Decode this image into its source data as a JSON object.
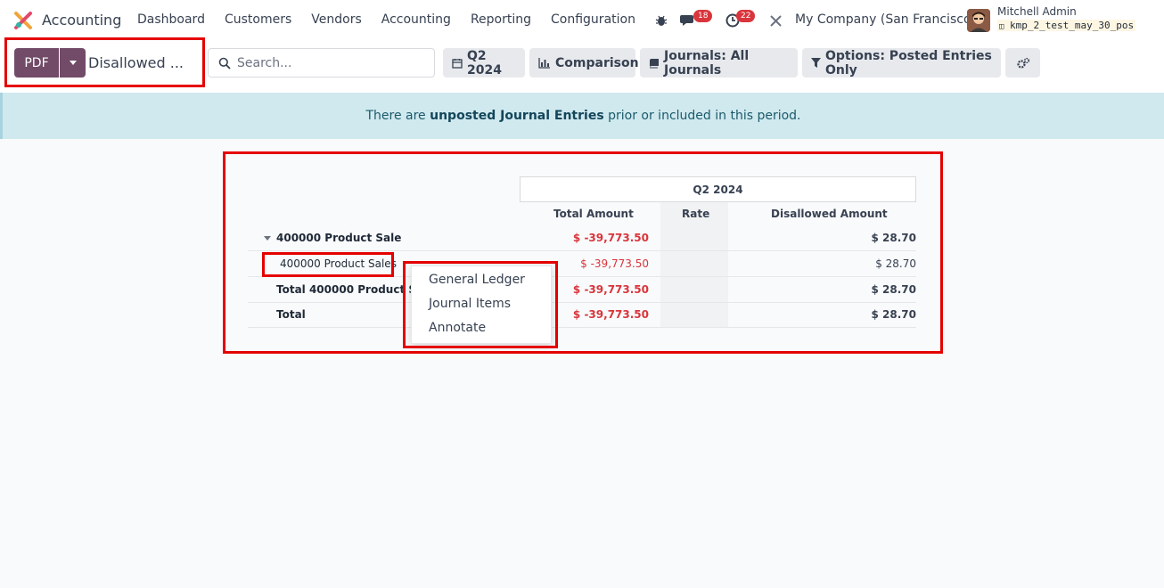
{
  "app": {
    "name": "Accounting",
    "menu": [
      "Dashboard",
      "Customers",
      "Vendors",
      "Accounting",
      "Reporting",
      "Configuration"
    ]
  },
  "systray": {
    "messages_count": "18",
    "activities_count": "22",
    "company": "My Company (San Francisco)",
    "user_name": "Mitchell Admin",
    "database": "kmp_2_test_may_30_pos"
  },
  "control": {
    "pdf_label": "PDF",
    "report_title": "Disallowed ...",
    "search_placeholder": "Search...",
    "filters": {
      "period": "Q2 2024",
      "comparison": "Comparison",
      "journals": "Journals: All Journals",
      "options": "Options: Posted Entries Only"
    }
  },
  "alert": {
    "prefix": "There are ",
    "emphasis": "unposted Journal Entries",
    "suffix": " prior or included in this period."
  },
  "report": {
    "period_header": "Q2 2024",
    "columns": [
      "Total Amount",
      "Rate",
      "Disallowed Amount"
    ],
    "rows": [
      {
        "label": "400000 Product Sale",
        "total_amount": "$ -39,773.50",
        "rate": "",
        "disallowed_amount": "$ 28.70"
      },
      {
        "label": "400000 Product Sales",
        "total_amount": "$ -39,773.50",
        "rate": "",
        "disallowed_amount": "$ 28.70"
      },
      {
        "label": "Total 400000 Product Sale",
        "total_amount": "$ -39,773.50",
        "rate": "",
        "disallowed_amount": "$ 28.70"
      },
      {
        "label": "Total",
        "total_amount": "$ -39,773.50",
        "rate": "",
        "disallowed_amount": "$ 28.70"
      }
    ]
  },
  "context_menu": {
    "items": [
      "General Ledger",
      "Journal Items",
      "Annotate"
    ]
  },
  "colors": {
    "brand": "#714b67",
    "negative": "#d9353c",
    "alert_bg": "#d0e9ef",
    "annotation": "#e50000"
  }
}
